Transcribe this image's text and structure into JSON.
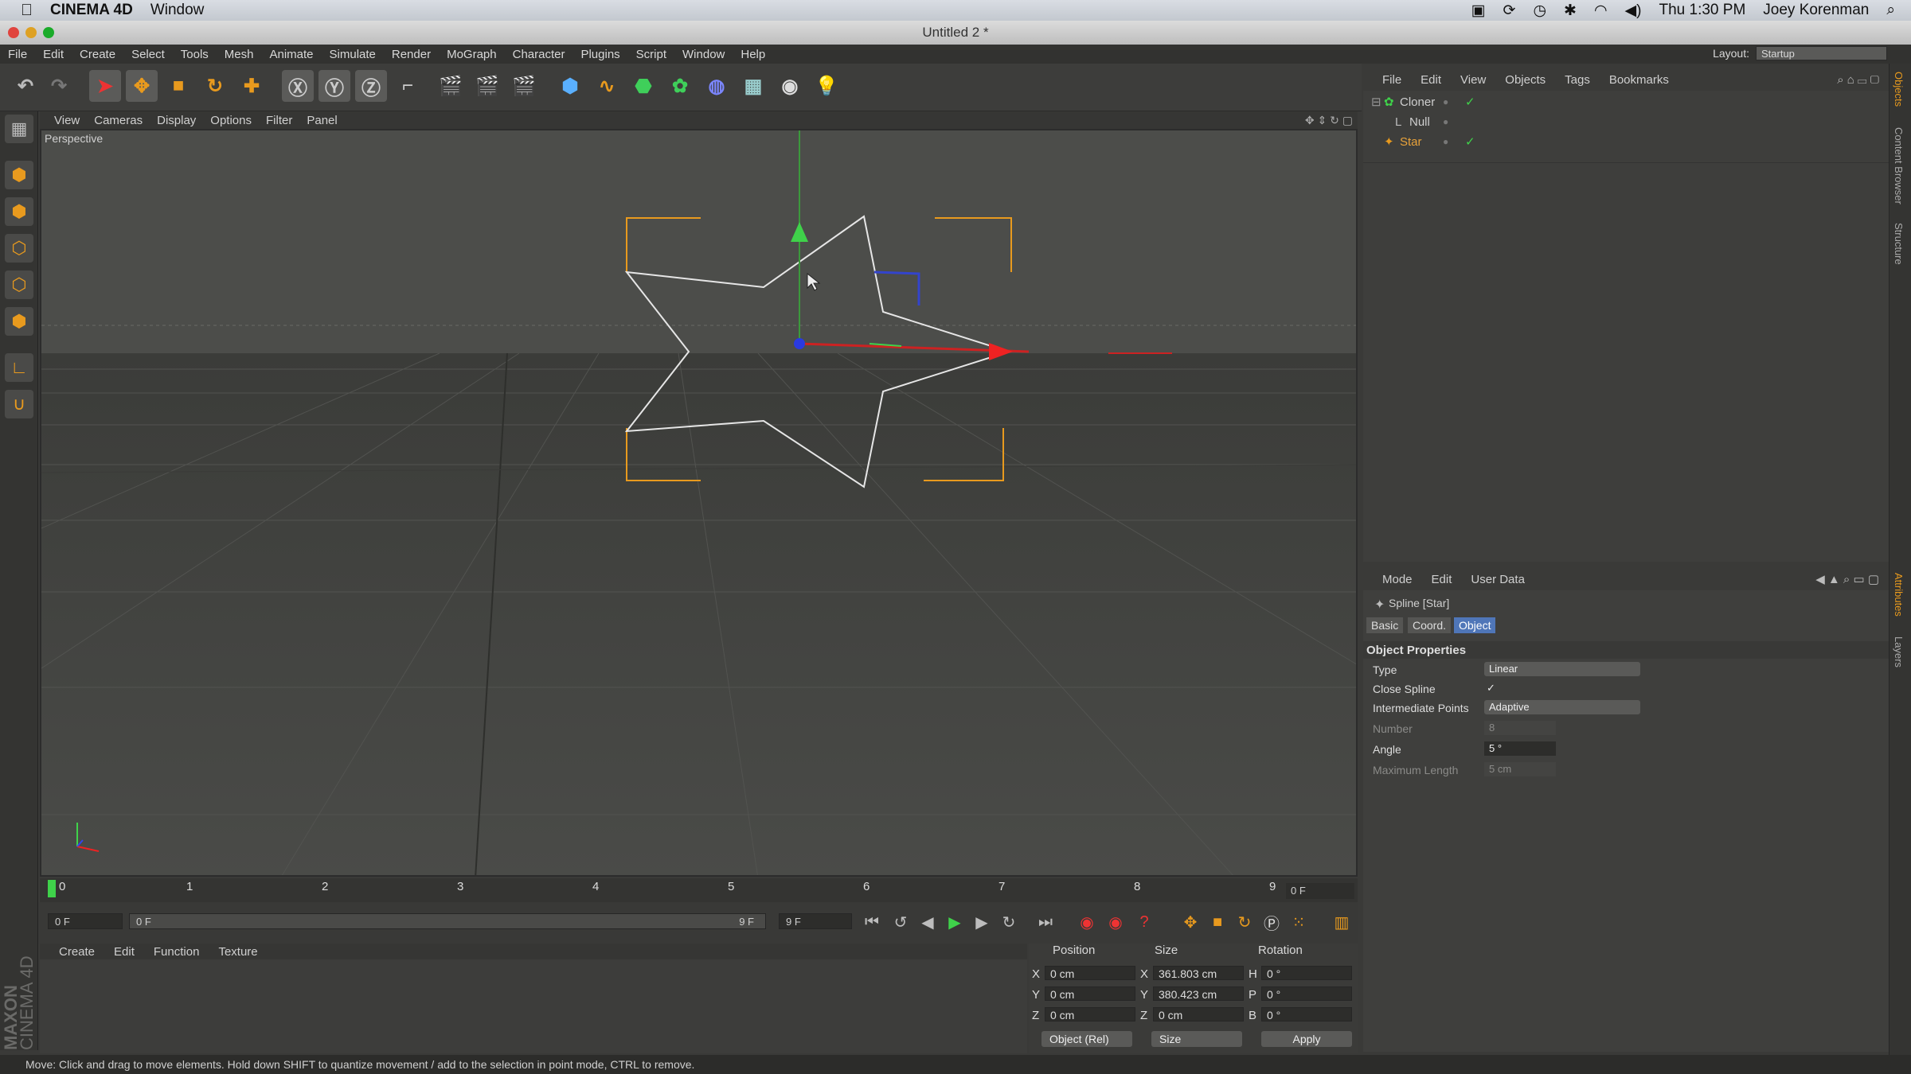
{
  "macbar": {
    "app": "CINEMA 4D",
    "window_menu": "Window",
    "clock": "Thu 1:30 PM",
    "user": "Joey Korenman"
  },
  "window": {
    "title": "Untitled 2 *"
  },
  "menu": [
    "File",
    "Edit",
    "Create",
    "Select",
    "Tools",
    "Mesh",
    "Animate",
    "Simulate",
    "Render",
    "MoGraph",
    "Character",
    "Plugins",
    "Script",
    "Window",
    "Help"
  ],
  "layout": {
    "label": "Layout:",
    "value": "Startup"
  },
  "viewport": {
    "menu": [
      "View",
      "Cameras",
      "Display",
      "Options",
      "Filter",
      "Panel"
    ],
    "label": "Perspective"
  },
  "timeline": {
    "ticks": [
      "0",
      "1",
      "2",
      "3",
      "4",
      "5",
      "6",
      "7",
      "8",
      "9"
    ],
    "current_frame": "0 F",
    "start_field": "0 F",
    "range_start": "0 F",
    "range_end": "9 F",
    "end_field": "9 F"
  },
  "material_manager": {
    "menu": [
      "Create",
      "Edit",
      "Function",
      "Texture"
    ]
  },
  "coordinates": {
    "headers": {
      "position": "Position",
      "size": "Size",
      "rotation": "Rotation"
    },
    "rows": [
      {
        "axis": "X",
        "pos": "0 cm",
        "size_axis": "X",
        "size": "361.803 cm",
        "rot_axis": "H",
        "rot": "0 °"
      },
      {
        "axis": "Y",
        "pos": "0 cm",
        "size_axis": "Y",
        "size": "380.423 cm",
        "rot_axis": "P",
        "rot": "0 °"
      },
      {
        "axis": "Z",
        "pos": "0 cm",
        "size_axis": "Z",
        "size": "0 cm",
        "rot_axis": "B",
        "rot": "0 °"
      }
    ],
    "mode_dropdown": "Object (Rel)",
    "size_dropdown": "Size",
    "apply": "Apply"
  },
  "object_manager": {
    "menu": [
      "File",
      "Edit",
      "View",
      "Objects",
      "Tags",
      "Bookmarks"
    ],
    "objects": [
      {
        "name": "Cloner",
        "selected": false
      },
      {
        "name": "Null",
        "selected": false
      },
      {
        "name": "Star",
        "selected": true
      }
    ]
  },
  "attributes": {
    "menu": [
      "Mode",
      "Edit",
      "User Data"
    ],
    "object_title": "Spline [Star]",
    "tabs": [
      "Basic",
      "Coord.",
      "Object"
    ],
    "active_tab": "Object",
    "section": "Object Properties",
    "props": {
      "type_label": "Type",
      "type_value": "Linear",
      "close_label": "Close Spline",
      "close_value": "✓",
      "inter_label": "Intermediate Points",
      "inter_value": "Adaptive",
      "number_label": "Number",
      "number_value": "8",
      "angle_label": "Angle",
      "angle_value": "5 °",
      "maxlen_label": "Maximum Length",
      "maxlen_value": "5 cm"
    }
  },
  "side_tabs": [
    "Objects",
    "Content Browser",
    "Structure",
    "Attributes",
    "Layers"
  ],
  "brand": {
    "line1": "MAXON",
    "line2": "CINEMA 4D"
  },
  "status": "Move: Click and drag to move elements. Hold down SHIFT to quantize movement / add to the selection in point mode, CTRL to remove.",
  "colors": {
    "accent_orange": "#e89a1e",
    "selected_object": "#e8a23a",
    "active_tab": "#4f76b8"
  }
}
